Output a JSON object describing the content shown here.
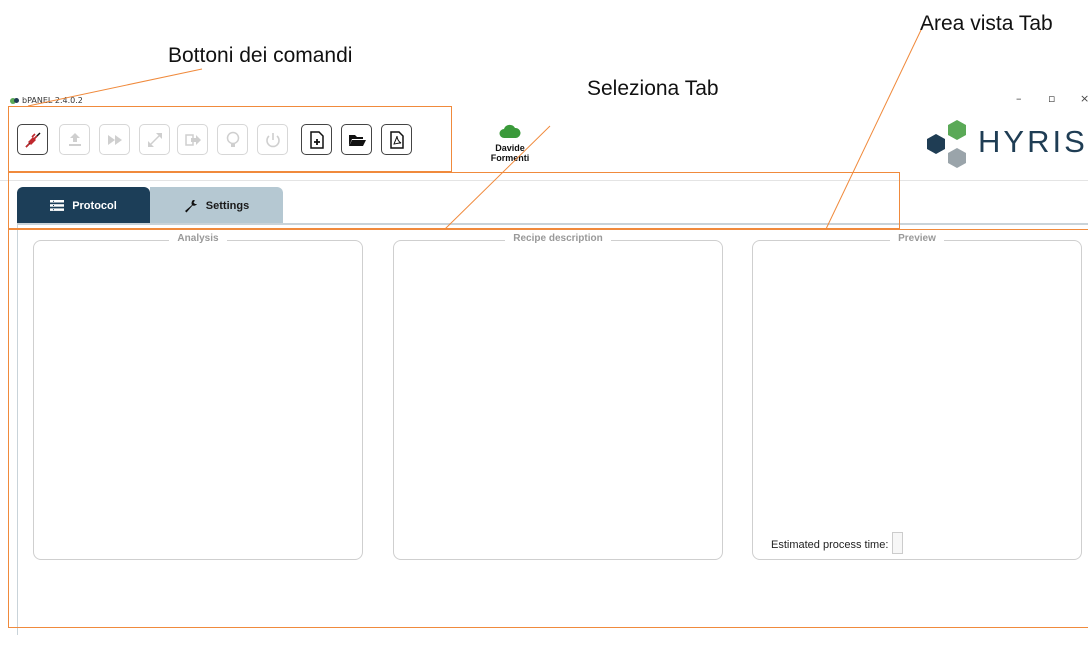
{
  "annotations": {
    "command_buttons": "Bottoni dei comandi",
    "select_tab": "Seleziona Tab",
    "tab_view_area": "Area vista Tab"
  },
  "window": {
    "title": "bPANEL 2.4.0.2",
    "minimize": "–",
    "maximize": "▫",
    "close": "×"
  },
  "toolbar": {
    "buttons": [
      {
        "icon": "disconnect-plug-icon",
        "enabled": true,
        "color": "#c0282d"
      },
      {
        "icon": "upload-icon",
        "enabled": false
      },
      {
        "icon": "fast-forward-icon",
        "enabled": false
      },
      {
        "icon": "expand-icon",
        "enabled": false
      },
      {
        "icon": "exit-icon",
        "enabled": false
      },
      {
        "icon": "lightbulb-icon",
        "enabled": false
      },
      {
        "icon": "power-icon",
        "enabled": false
      },
      {
        "icon": "new-file-icon",
        "enabled": true
      },
      {
        "icon": "open-folder-icon",
        "enabled": true
      },
      {
        "icon": "pdf-icon",
        "enabled": true
      }
    ]
  },
  "user": {
    "name": "Davide Formenti",
    "cloud_color": "#3a9a3a"
  },
  "brand": {
    "name": "HYRIS",
    "colors": [
      "#5aa957",
      "#1f3d54",
      "#9aa4aa"
    ]
  },
  "tabs": [
    {
      "label": "Protocol",
      "icon": "list-icon",
      "active": true
    },
    {
      "label": "Settings",
      "icon": "wrench-icon",
      "active": false
    }
  ],
  "panels": {
    "analysis": {
      "title": "Analysis"
    },
    "recipe": {
      "title": "Recipe description"
    },
    "preview": {
      "title": "Preview",
      "estimated_label": "Estimated process time:",
      "estimated_value": ""
    }
  },
  "colors": {
    "annotation": "#f08a3c",
    "tab_active": "#1c3e58",
    "tab_inactive": "#b5c8d2"
  }
}
